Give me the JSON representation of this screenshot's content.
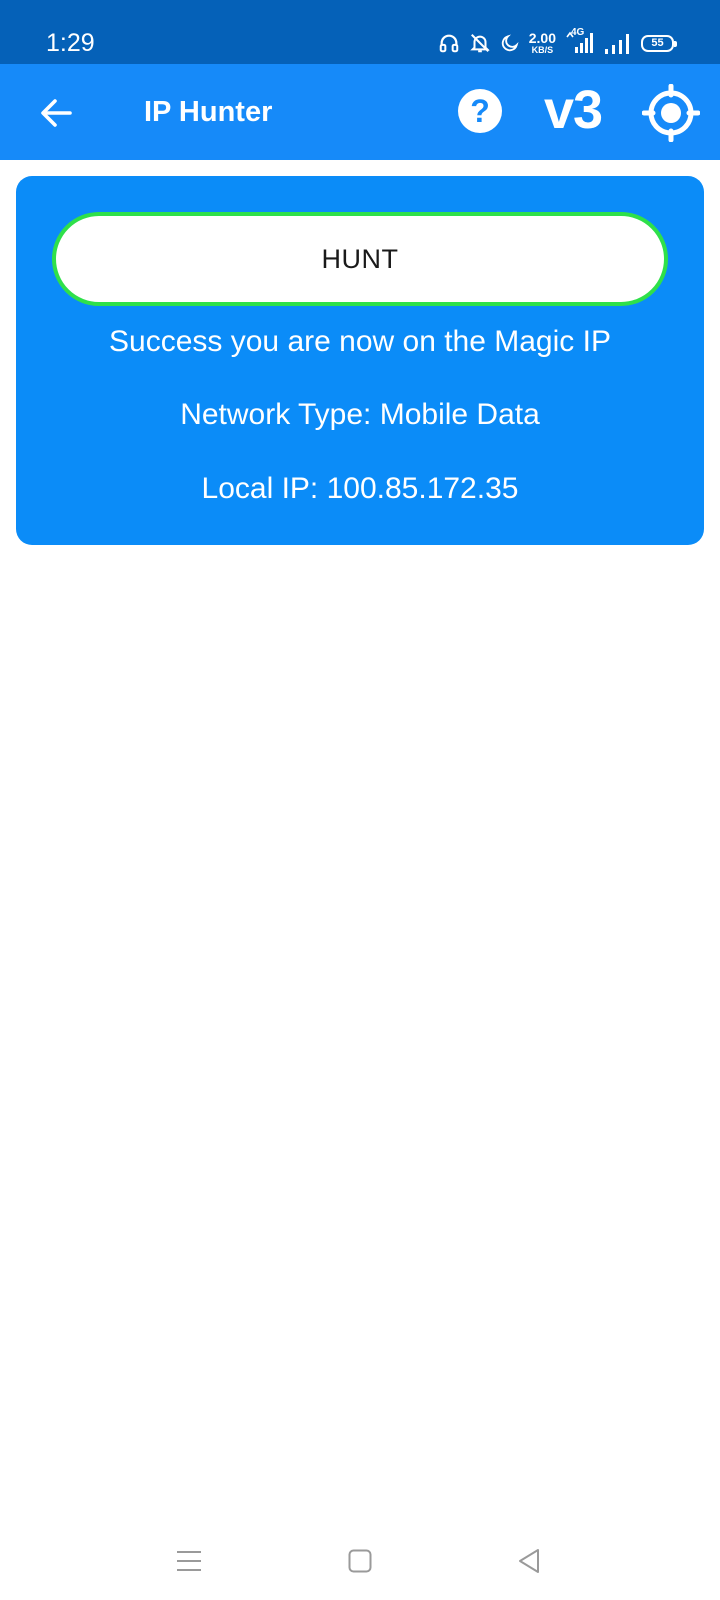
{
  "status_bar": {
    "time": "1:29",
    "net_speed_value": "2.00",
    "net_speed_unit": "KB/S",
    "network": "4G",
    "battery": "55",
    "icons": [
      "headset-icon",
      "bell-off-icon",
      "moon-icon",
      "mobile-signal-icon",
      "signal-icon",
      "battery-icon"
    ]
  },
  "app_bar": {
    "title": "IP Hunter",
    "help_glyph": "?",
    "version_label": "v3",
    "icons": [
      "back-arrow-icon",
      "help-icon",
      "target-icon"
    ]
  },
  "card": {
    "hunt_button_label": "HUNT",
    "status_message": "Success you are now on the Magic IP",
    "network_type": "Network Type: Mobile Data",
    "local_ip": "Local IP: 100.85.172.35"
  },
  "nav_bar": {
    "icons": [
      "menu-icon",
      "home-icon",
      "back-icon"
    ]
  },
  "colors": {
    "status_bar": "#0561b8",
    "app_bar": "#168af9",
    "card": "#0b8cf8",
    "hunt_border": "#2fe04a"
  }
}
